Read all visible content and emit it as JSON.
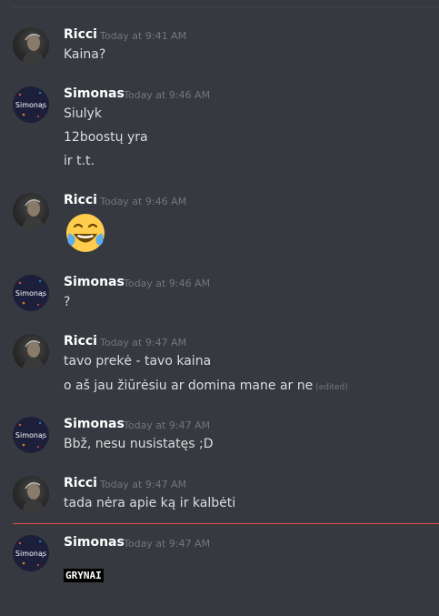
{
  "messages": [
    {
      "author": "Ricci",
      "time": "Today at 9:41 AM",
      "lines": [
        "Kaina?"
      ]
    },
    {
      "author": "Simonas",
      "time": "Today at 9:46 AM",
      "lines": [
        "Siulyk",
        "12boostų yra",
        "ir t.t."
      ]
    },
    {
      "author": "Ricci",
      "time": "Today at 9:46 AM",
      "emoji": "joy-emoji"
    },
    {
      "author": "Simonas",
      "time": "Today at 9:46 AM",
      "lines": [
        "?"
      ]
    },
    {
      "author": "Ricci",
      "time": "Today at 9:47 AM",
      "lines": [
        "tavo prekė - tavo kaina",
        "o aš jau žiūrėsiu ar domina mane ar ne"
      ],
      "edited": "(edited)"
    },
    {
      "author": "Simonas",
      "time": "Today at 9:47 AM",
      "lines": [
        "Bbž, nesu nusistatęs ;D"
      ]
    },
    {
      "author": "Ricci",
      "time": "Today at 9:47 AM",
      "lines": [
        "tada nėra apie ką ir kalbėti"
      ]
    },
    {
      "author": "Simonas",
      "time": "Today at 9:47 AM",
      "code": "GRYNAI"
    }
  ],
  "avatars": {
    "simonas_text": "Simonas"
  },
  "colors": {
    "background": "#36393f",
    "username": "#ffffff",
    "timestamp": "#72767d",
    "text": "#dcddde",
    "new_messages_divider": "#f04747"
  }
}
